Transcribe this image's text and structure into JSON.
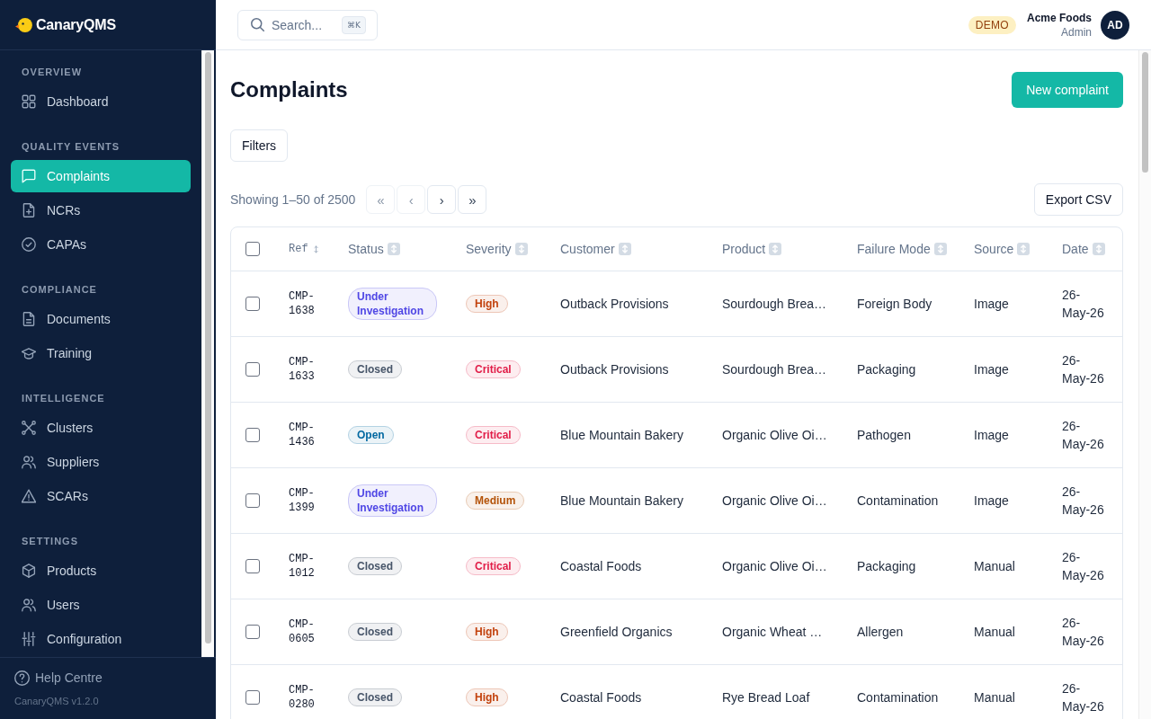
{
  "sidebar": {
    "brand": "CanaryQMS",
    "sections": [
      {
        "title": "OVERVIEW",
        "items": [
          {
            "label": "Dashboard",
            "selected": false
          }
        ]
      },
      {
        "title": "QUALITY EVENTS",
        "items": [
          {
            "label": "Complaints",
            "selected": true
          },
          {
            "label": "NCRs",
            "selected": false
          },
          {
            "label": "CAPAs",
            "selected": false
          }
        ]
      },
      {
        "title": "COMPLIANCE",
        "items": [
          {
            "label": "Documents",
            "selected": false
          },
          {
            "label": "Training",
            "selected": false
          }
        ]
      },
      {
        "title": "INTELLIGENCE",
        "items": [
          {
            "label": "Clusters",
            "selected": false
          },
          {
            "label": "Suppliers",
            "selected": false
          },
          {
            "label": "SCARs",
            "selected": false
          }
        ]
      },
      {
        "title": "SETTINGS",
        "items": [
          {
            "label": "Products",
            "selected": false
          },
          {
            "label": "Users",
            "selected": false
          },
          {
            "label": "Configuration",
            "selected": false
          }
        ]
      }
    ],
    "help_link": "Help Centre",
    "version": "CanaryQMS v1.2.0"
  },
  "topbar": {
    "search": {
      "placeholder": "Search...",
      "shortcut": "⌘K"
    },
    "mode_tag": "DEMO",
    "account": {
      "name": "Acme Foods",
      "role": "Admin",
      "initials": "AD"
    }
  },
  "page": {
    "title": "Complaints",
    "new_button": "New complaint",
    "filters_button": "Filters",
    "result_count": "Showing 1–50 of 2500",
    "pager": [
      {
        "symbol": "«",
        "disabled": true
      },
      {
        "symbol": "‹",
        "disabled": true
      },
      {
        "symbol": "›",
        "disabled": false
      },
      {
        "symbol": "»",
        "disabled": false
      }
    ],
    "export_button": "Export CSV"
  },
  "table": {
    "select_all": {
      "checked": false
    },
    "columns": [
      {
        "label": "Ref",
        "kind": "mono"
      },
      {
        "label": "Status",
        "kind": "sortable"
      },
      {
        "label": "Severity",
        "kind": "sortable"
      },
      {
        "label": "Customer",
        "kind": "sortable"
      },
      {
        "label": "Product",
        "kind": "sortable"
      },
      {
        "label": "Failure Mode",
        "kind": "sortable"
      },
      {
        "label": "Source",
        "kind": "sortable"
      },
      {
        "label": "Date",
        "kind": "sortable"
      }
    ],
    "rows": [
      {
        "checked": false,
        "ref": "CMP-1638",
        "status": {
          "label": "Under Investigation",
          "color": "#4f46e5"
        },
        "severity": {
          "label": "High",
          "color": "#c2410c"
        },
        "customer": "Outback Provisions",
        "product": "Sourdough Brea…",
        "failure_mode": "Foreign Body",
        "source": "Image",
        "date": "26-May-26"
      },
      {
        "checked": false,
        "ref": "CMP-1633",
        "status": {
          "label": "Closed",
          "color": "#475569"
        },
        "severity": {
          "label": "Critical",
          "color": "#e11d48"
        },
        "customer": "Outback Provisions",
        "product": "Sourdough Brea…",
        "failure_mode": "Packaging",
        "source": "Image",
        "date": "26-May-26"
      },
      {
        "checked": false,
        "ref": "CMP-1436",
        "status": {
          "label": "Open",
          "color": "#0369a1"
        },
        "severity": {
          "label": "Critical",
          "color": "#e11d48"
        },
        "customer": "Blue Mountain Bakery",
        "product": "Organic Olive Oi…",
        "failure_mode": "Pathogen",
        "source": "Image",
        "date": "26-May-26"
      },
      {
        "checked": false,
        "ref": "CMP-1399",
        "status": {
          "label": "Under Investigation",
          "color": "#4f46e5"
        },
        "severity": {
          "label": "Medium",
          "color": "#b45309"
        },
        "customer": "Blue Mountain Bakery",
        "product": "Organic Olive Oi…",
        "failure_mode": "Contamination",
        "source": "Image",
        "date": "26-May-26"
      },
      {
        "checked": false,
        "ref": "CMP-1012",
        "status": {
          "label": "Closed",
          "color": "#475569"
        },
        "severity": {
          "label": "Critical",
          "color": "#e11d48"
        },
        "customer": "Coastal Foods",
        "product": "Organic Olive Oi…",
        "failure_mode": "Packaging",
        "source": "Manual",
        "date": "26-May-26"
      },
      {
        "checked": false,
        "ref": "CMP-0605",
        "status": {
          "label": "Closed",
          "color": "#475569"
        },
        "severity": {
          "label": "High",
          "color": "#c2410c"
        },
        "customer": "Greenfield Organics",
        "product": "Organic Wheat …",
        "failure_mode": "Allergen",
        "source": "Manual",
        "date": "26-May-26"
      },
      {
        "checked": false,
        "ref": "CMP-0280",
        "status": {
          "label": "Closed",
          "color": "#475569"
        },
        "severity": {
          "label": "High",
          "color": "#c2410c"
        },
        "customer": "Coastal Foods",
        "product": "Rye Bread Loaf",
        "failure_mode": "Contamination",
        "source": "Manual",
        "date": "26-May-26"
      }
    ]
  }
}
